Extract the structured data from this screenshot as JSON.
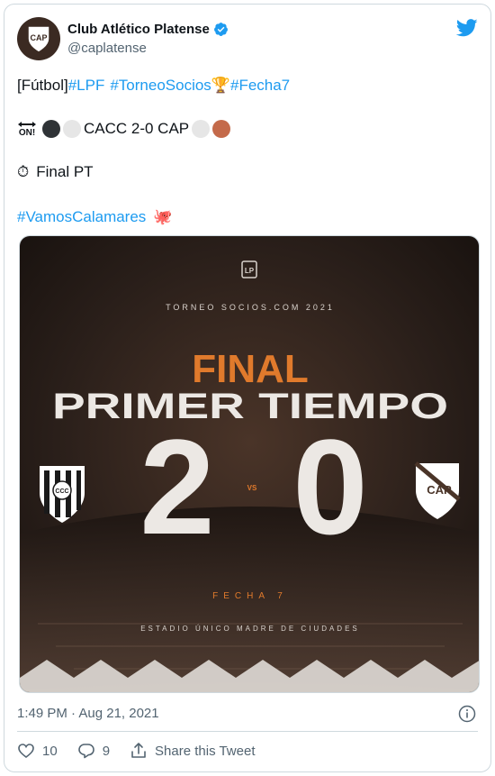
{
  "header": {
    "name": "Club Atlético Platense",
    "handle": "@caplatense",
    "avatar_text": "CAP"
  },
  "tweet": {
    "line1": {
      "prefix": "[Fútbol] ",
      "tags": [
        "#LPF",
        "#TorneoSocios",
        "#Fecha7"
      ],
      "trophy": "🏆"
    },
    "line2": {
      "on_label": "ON!",
      "score_text": "CACC 2-0 CAP"
    },
    "line3": {
      "stopwatch": "⏱",
      "text": "Final PT"
    },
    "line4": {
      "tag": "#VamosCalamares",
      "octopus": "🐙"
    }
  },
  "media": {
    "tournament": "TORNEO SOCIOS.COM 2021",
    "final_word": "FINAL",
    "subtitle": "PRIMER TIEMPO",
    "home_score": "2",
    "away_score": "0",
    "vs": "VS",
    "fecha": "FECHA 7",
    "stadium": "ESTADIO ÚNICO MADRE DE CIUDADES",
    "away_badge": "CAP",
    "home_badge": "CCC"
  },
  "meta": {
    "timestamp": "1:49 PM · Aug 21, 2021"
  },
  "actions": {
    "likes": "10",
    "replies": "9",
    "share_label": "Share this Tweet"
  },
  "colors": {
    "link": "#1d9bf0",
    "accent_orange": "#e07a2c",
    "media_bg": "#2a1f1a",
    "dark_circle": "#2f3336",
    "light_circle": "#e6e6e6",
    "brown_circle": "#c46a4a"
  }
}
